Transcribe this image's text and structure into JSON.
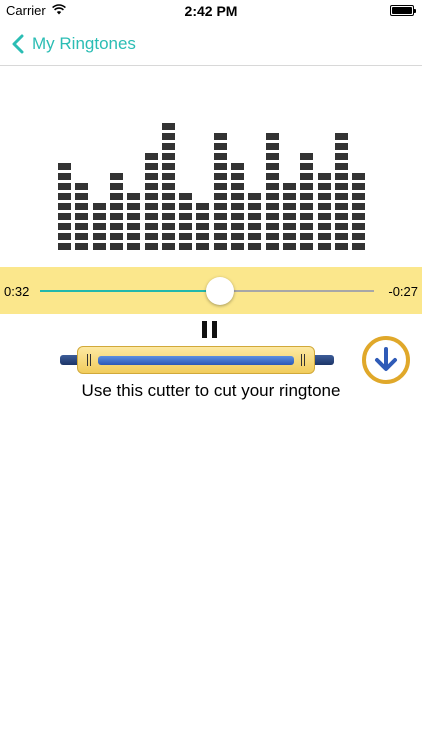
{
  "status_bar": {
    "carrier": "Carrier",
    "time": "2:42 PM"
  },
  "nav": {
    "back_label": "My Ringtones",
    "accent_color": "#2bbdb4"
  },
  "equalizer": {
    "color": "#333333",
    "levels": [
      9,
      7,
      5,
      8,
      6,
      10,
      13,
      6,
      5,
      12,
      9,
      6,
      12,
      7,
      10,
      8,
      12,
      8
    ]
  },
  "player": {
    "elapsed": "0:32",
    "remaining": "-0:27",
    "progress": 0.54,
    "band_color": "#fbe78c",
    "progress_color": "#22b8ac",
    "pause_icon": "pause-icon"
  },
  "cutter": {
    "caption": "Use this cutter to cut your ringtone",
    "selection_start": 0.0,
    "selection_end": 1.0
  },
  "download": {
    "icon": "download-arrow-icon",
    "ring_color": "#e0a82a",
    "arrow_color": "#2f5bb7"
  }
}
